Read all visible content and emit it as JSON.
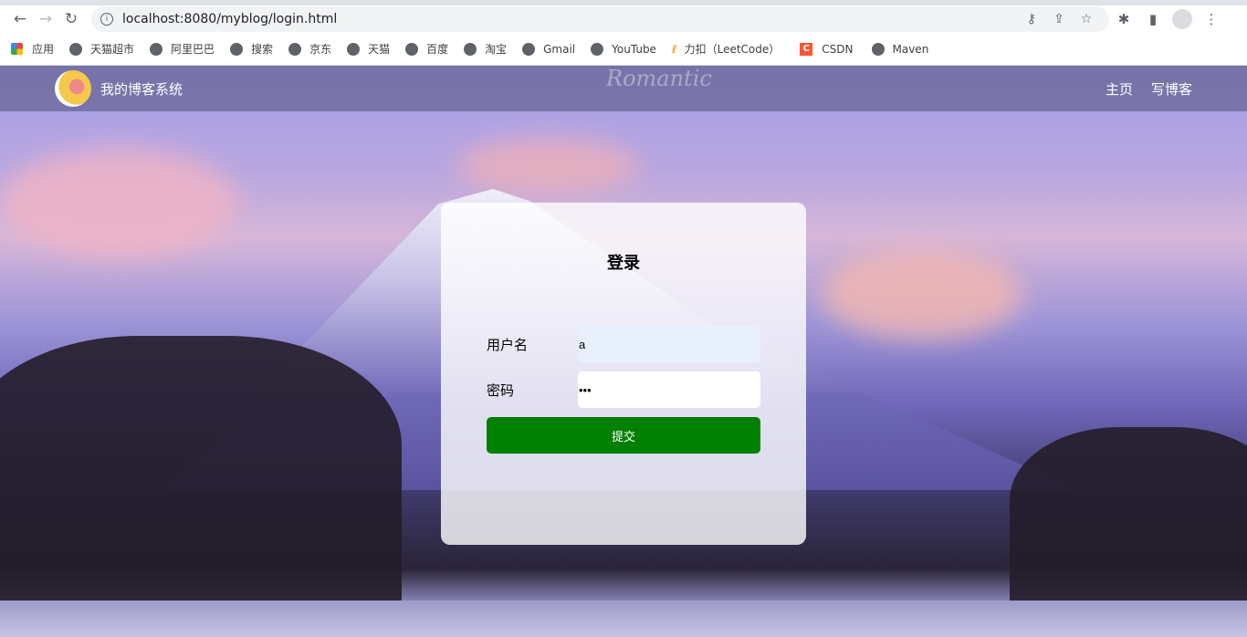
{
  "browser": {
    "url": "localhost:8080/myblog/login.html",
    "bookmarks": [
      "应用",
      "天猫超市",
      "阿里巴巴",
      "搜索",
      "京东",
      "天猫",
      "百度",
      "淘宝",
      "Gmail",
      "YouTube",
      "力扣（LeetCode）",
      "CSDN",
      "Maven"
    ]
  },
  "nav": {
    "brand": "我的博客系统",
    "watermark": "Romantic",
    "links": [
      "主页",
      "写博客"
    ]
  },
  "login": {
    "title": "登录",
    "username_label": "用户名",
    "username_value": "a",
    "password_label": "密码",
    "password_value": "•••",
    "submit": "提交"
  }
}
